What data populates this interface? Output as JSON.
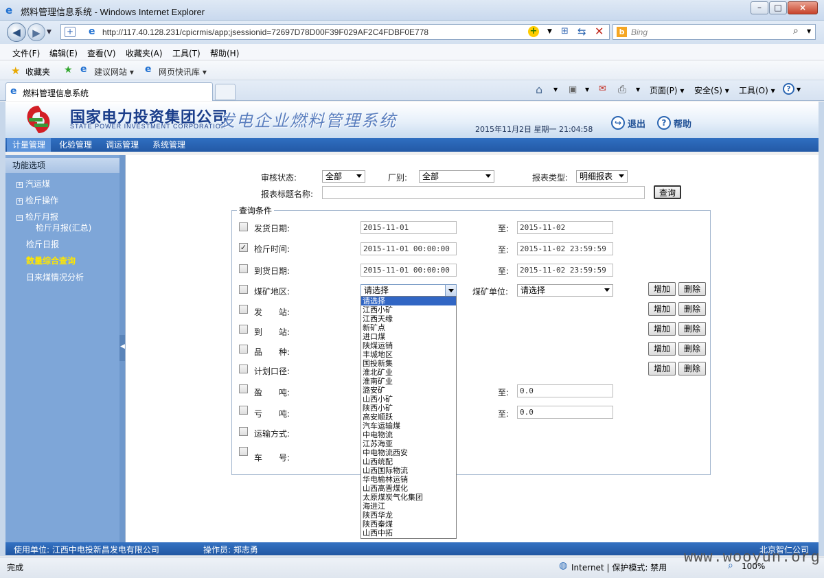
{
  "window": {
    "title": "燃料管理信息系统 - Windows Internet Explorer",
    "url": "http://117.40.128.231/cpicrmis/app;jsessionid=72697D78D00F39F029AF2C4FDBF0E778",
    "search_placeholder": "Bing",
    "menu": [
      "文件(F)",
      "编辑(E)",
      "查看(V)",
      "收藏夹(A)",
      "工具(T)",
      "帮助(H)"
    ],
    "favorites": {
      "label": "收藏夹",
      "items": [
        "建议网站 ▾",
        "网页快讯库 ▾"
      ]
    },
    "tab_title": "燃料管理信息系统",
    "commands": [
      "页面(P) ▾",
      "安全(S) ▾",
      "工具(O) ▾"
    ]
  },
  "header": {
    "company_cn": "国家电力投资集团公司",
    "company_en": "STATE POWER INVESTMENT CORPORATION",
    "system_name": "发电企业燃料管理系统",
    "datetime": "2015年11月2日 星期一 21:04:58",
    "logout": "退出",
    "help": "帮助"
  },
  "nav": [
    "计量管理",
    "化验管理",
    "调运管理",
    "系统管理"
  ],
  "sidebar": {
    "title": "功能选项",
    "items": [
      "汽运煤",
      "检斤操作",
      "检斤月报",
      "检斤月报(汇总)",
      "检斤日报",
      "数量综合查询",
      "日来煤情况分析"
    ]
  },
  "filters": {
    "audit_label": "审核状态:",
    "audit_value": "全部",
    "plant_label": "厂别:",
    "plant_value": "全部",
    "report_type_label": "报表类型:",
    "report_type_value": "明细报表",
    "title_label": "报表标题名称:",
    "title_value": "",
    "query_button": "查询"
  },
  "query": {
    "legend": "查询条件",
    "to_label": "至:",
    "ship_date": {
      "label": "发货日期:",
      "from": "2015-11-01",
      "to": "2015-11-02",
      "checked": false
    },
    "weigh_time": {
      "label": "检斤时间:",
      "from": "2015-11-01 00:00:00",
      "to": "2015-11-02 23:59:59",
      "checked": true
    },
    "arrive_date": {
      "label": "到货日期:",
      "from": "2015-11-01 00:00:00",
      "to": "2015-11-02 23:59:59",
      "checked": false
    },
    "mine_region": {
      "label": "煤矿地区:",
      "value": "请选择"
    },
    "mine_unit": {
      "label": "煤矿单位:",
      "value": "请选择"
    },
    "send_station": "发　　站:",
    "arrive_station": "到　　站:",
    "variety": "品　　种:",
    "plan_caliber": "计划口径:",
    "surplus_ton": {
      "label": "盈　　吨:",
      "to": "0.0"
    },
    "loss_ton": {
      "label": "亏　　吨:",
      "to": "0.0"
    },
    "transport": "运输方式:",
    "car_no": "车　　号:",
    "add_button": "增加",
    "delete_button": "删除"
  },
  "dropdown_options": [
    "请选择",
    "江西小矿",
    "江西天缘",
    "新矿点",
    "进口煤",
    "陕煤运销",
    "丰城地区",
    "国投新集",
    "淮北矿业",
    "淮南矿业",
    "潞安矿",
    "山西小矿",
    "陕西小矿",
    "高安顺跃",
    "汽车运输煤",
    "中电物流",
    "江苏海亚",
    "中电物流西安",
    "山西统配",
    "山西国际物流",
    "华电榆林运销",
    "山西高晋煤化",
    "太原煤炭气化集团",
    "海进江",
    "陕西华龙",
    "陕西秦煤",
    "山西中拓"
  ],
  "footer": {
    "unit": "使用单位: 江西中电投新昌发电有限公司",
    "operator": "操作员: 郑志勇",
    "vendor": "北京智仁公司"
  },
  "status": {
    "left": "完成",
    "zone": "Internet | 保护模式: 禁用",
    "zoom": "100%"
  },
  "watermark": "www.wooyun.org"
}
